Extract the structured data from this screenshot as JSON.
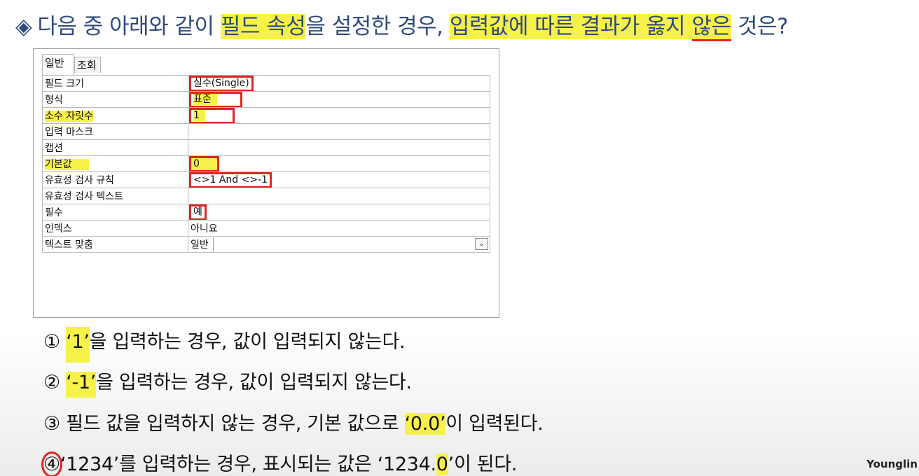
{
  "question": {
    "bullet": "◈",
    "part1": "다음 중 아래와 같이 ",
    "hl1": "필드 속성",
    "part2": "을 설정한 경우, ",
    "hl2": "입력값에 따른 결과가 옳지 ",
    "hl3_underlined": "않은",
    "part3": " 것은?"
  },
  "dialog": {
    "tabs": [
      "일반",
      "조회"
    ],
    "properties": [
      {
        "name": "필드 크기",
        "value": "실수(Single)"
      },
      {
        "name": "형식",
        "value": "표준"
      },
      {
        "name": "소수 자릿수",
        "value": "1"
      },
      {
        "name": "입력 마스크",
        "value": ""
      },
      {
        "name": "캡션",
        "value": ""
      },
      {
        "name": "기본값",
        "value": "0"
      },
      {
        "name": "유효성 검사 규칙",
        "value": "<>1 And <>-1"
      },
      {
        "name": "유효성 검사 텍스트",
        "value": ""
      },
      {
        "name": "필수",
        "value": "예"
      },
      {
        "name": "인덱스",
        "value": "아니요"
      },
      {
        "name": "텍스트 맞춤",
        "value": "일반"
      }
    ]
  },
  "options": {
    "o1": {
      "num": "①",
      "hl": "‘1’",
      "rest": "을 입력하는 경우, 값이 입력되지 않는다."
    },
    "o2": {
      "num": "②",
      "hl": "‘-1’",
      "rest": "을 입력하는 경우, 값이 입력되지 않는다."
    },
    "o3": {
      "num": "③",
      "pre": " 필드 값을 입력하지 않는 경우, 기본 값으로 ",
      "hl": "‘0.0’",
      "post": "이 입력된다."
    },
    "o4": {
      "num": "④",
      "pre": "‘1234’를 입력하는 경우, 표시되는 값은 ‘1234.",
      "hl": "0",
      "post": "’이 된다."
    }
  },
  "watermark": "Younglin",
  "colors": {
    "highlight": "#f7f24a",
    "annotation_red": "#e0251f",
    "title_blue": "#2f4b7c"
  }
}
